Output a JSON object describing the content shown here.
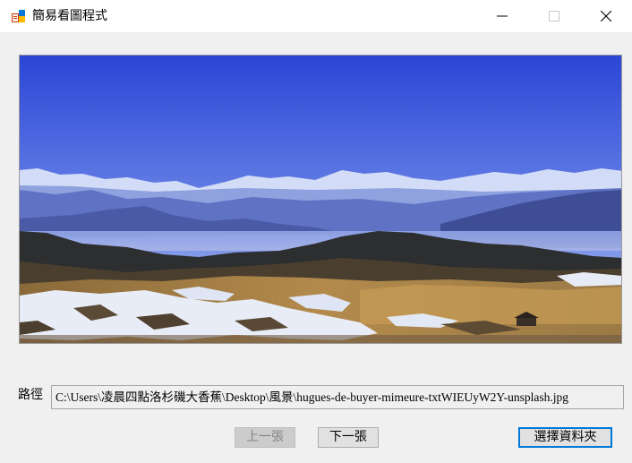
{
  "window": {
    "title": "簡易看圖程式",
    "controls": {
      "minimize": "—",
      "maximize": "☐",
      "close": "✕"
    }
  },
  "path": {
    "label": "路徑",
    "value": "C:\\Users\\凌晨四點洛杉磯大香蕉\\Desktop\\風景\\hugues-de-buyer-mimeure-txtWIEUyW2Y-unsplash.jpg"
  },
  "buttons": {
    "previous": {
      "label": "上一張",
      "enabled": false
    },
    "next": {
      "label": "下一張",
      "enabled": true
    },
    "choose_folder": {
      "label": "選擇資料夾",
      "enabled": true
    }
  },
  "colors": {
    "window_bg": "#f0f0f0",
    "titlebar_bg": "#ffffff",
    "focus_border": "#0078d7"
  }
}
